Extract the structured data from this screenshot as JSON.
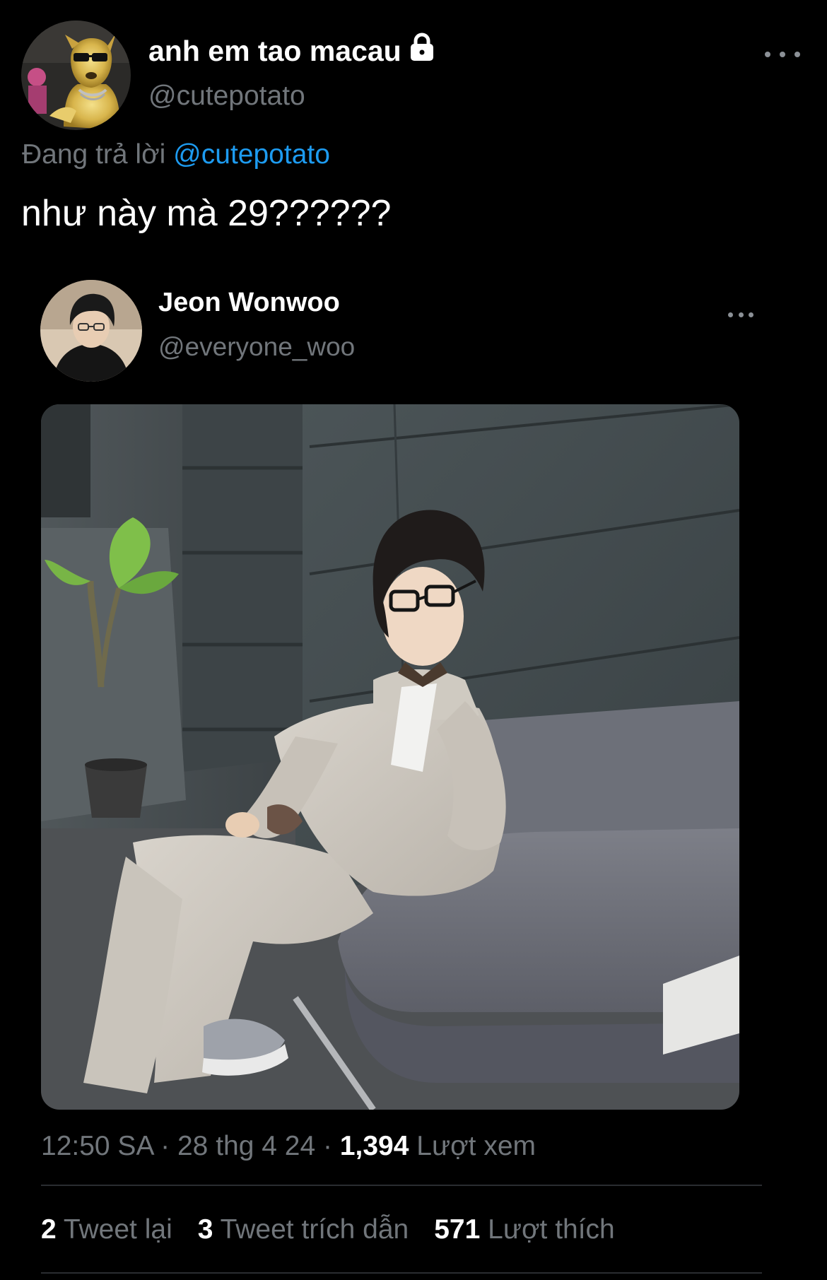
{
  "author": {
    "display_name": "anh em tao macau",
    "handle": "@cutepotato",
    "protected_icon": "lock-icon"
  },
  "reply": {
    "prefix": "Đang trả lời",
    "to": "@cutepotato"
  },
  "tweet": {
    "text": "như này mà 29??????"
  },
  "quoted": {
    "display_name": "Jeon Wonwoo",
    "handle": "@everyone_woo"
  },
  "meta": {
    "time": "12:50 SA",
    "date": "28 thg 4 24",
    "views_count": "1,394",
    "views_label": "Lượt xem"
  },
  "stats": {
    "retweets_count": "2",
    "retweets_label": "Tweet lại",
    "quotes_count": "3",
    "quotes_label": "Tweet trích dẫn",
    "likes_count": "571",
    "likes_label": "Lượt thích"
  },
  "colors": {
    "background": "#000000",
    "link": "#1d9bf0",
    "secondary_text": "#71767b"
  }
}
